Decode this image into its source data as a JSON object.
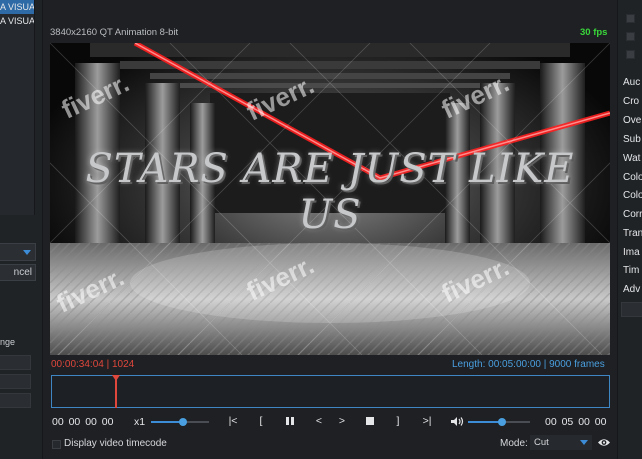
{
  "left_panel": {
    "items": [
      "A VISUA",
      "A VISUA"
    ],
    "cancel_label": "ncel",
    "range_label": "nge"
  },
  "viewer": {
    "format_label": "3840x2160 QT Animation 8-bit",
    "fps_label": "30 fps",
    "video_title": "STARS ARE JUST LIKE US",
    "watermark_text": "fiverr."
  },
  "timeline": {
    "current_timecode": "00:00:34:04 | 1024",
    "length_label": "Length: 00:05:00:00 | 9000 frames",
    "playhead_fraction": 0.113
  },
  "transport": {
    "start_timecode": "00 00 00 00",
    "end_timecode": "00 05 00 00",
    "speed_label": "x1",
    "speed_level": 0.55,
    "volume_level": 0.55,
    "rewind_label": "|<",
    "mark_in_label": "[",
    "prev_frame_label": "<",
    "next_frame_label": ">",
    "mark_out_label": "]",
    "forward_label": ">|",
    "play_state": "playing"
  },
  "bottom_bar": {
    "timecode_checkbox_label": "Display video timecode",
    "mode_label": "Mode:",
    "mode_value": "Cut"
  },
  "right_panel": {
    "items": [
      "Auc",
      "Cro",
      "Ove",
      "Sub",
      "Wat",
      "Colo",
      "Colo",
      "Corr",
      "Tran",
      "Ima",
      "Tim",
      "Adv"
    ]
  },
  "colors": {
    "accent": "#3c8cd8",
    "timecode_red": "#e0473c",
    "fps_green": "#39d63a",
    "laser_red": "#ff1e1e"
  }
}
